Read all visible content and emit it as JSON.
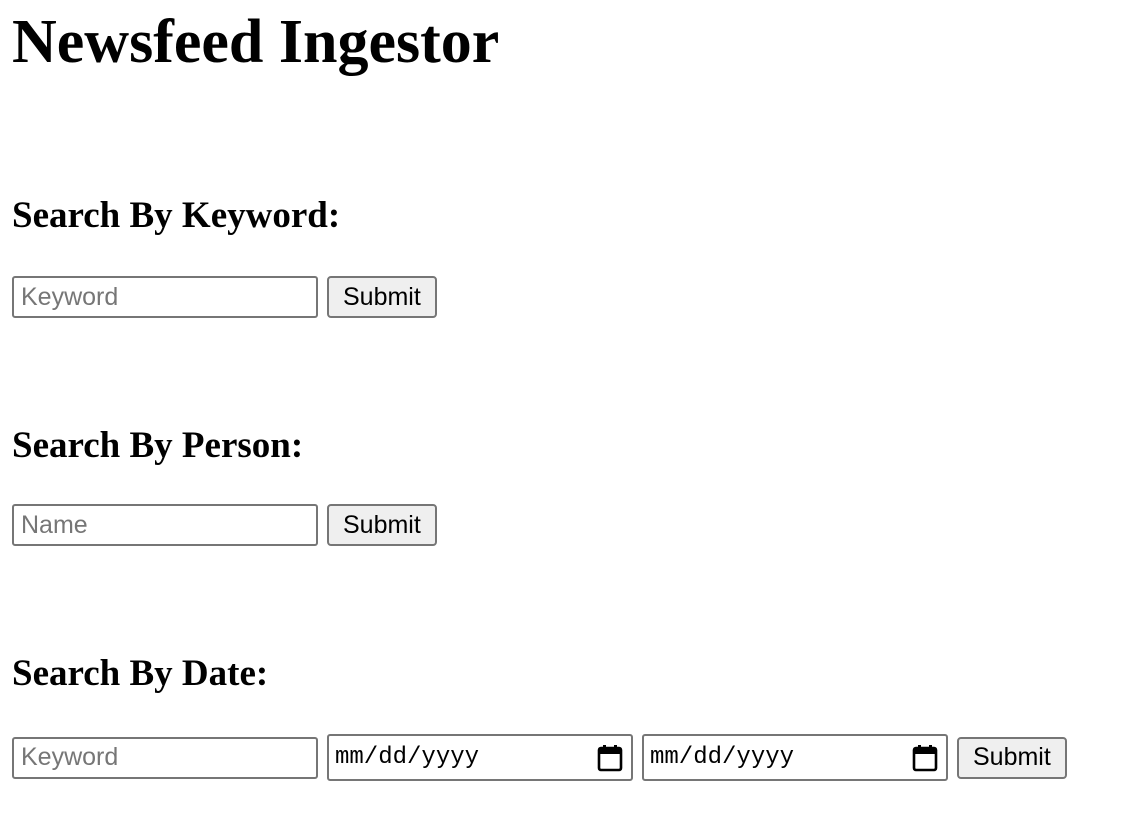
{
  "page": {
    "title": "Newsfeed Ingestor"
  },
  "keyword_search": {
    "heading": "Search By Keyword:",
    "input_placeholder": "Keyword",
    "input_value": "",
    "submit_label": "Submit"
  },
  "person_search": {
    "heading": "Search By Person:",
    "input_placeholder": "Name",
    "input_value": "",
    "submit_label": "Submit"
  },
  "date_search": {
    "heading": "Search By Date:",
    "keyword_placeholder": "Keyword",
    "keyword_value": "",
    "start_date_display": "mm/dd/yyyy",
    "end_date_display": "mm/dd/yyyy",
    "calendar_icon": "calendar-icon",
    "submit_label": "Submit"
  }
}
